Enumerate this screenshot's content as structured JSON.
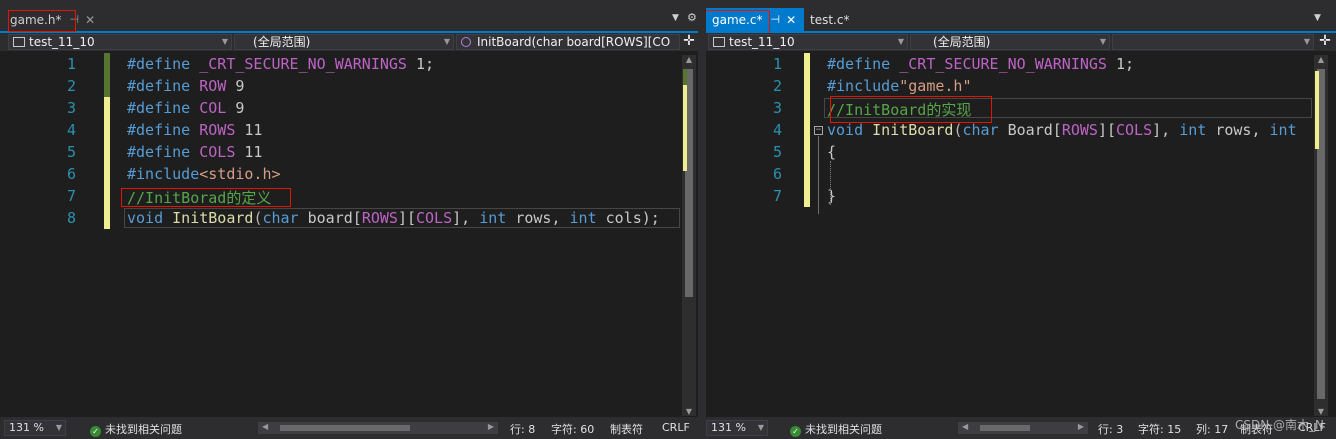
{
  "left": {
    "tabs": [
      {
        "label": "game.h*",
        "pin": "⊣",
        "close": "✕"
      }
    ],
    "nav": {
      "project": "test_11_10",
      "scope": "(全局范围)",
      "member": "InitBoard(char board[ROWS][CO"
    },
    "lines": [
      {
        "n": "1",
        "parts": [
          [
            "kw",
            "#define "
          ],
          [
            "mac",
            "_CRT_SECURE_NO_WARNINGS"
          ],
          [
            "id",
            " 1;"
          ]
        ]
      },
      {
        "n": "2",
        "parts": [
          [
            "kw",
            "#define "
          ],
          [
            "mac",
            "ROW"
          ],
          [
            "id",
            " 9"
          ]
        ]
      },
      {
        "n": "3",
        "parts": [
          [
            "kw",
            "#define "
          ],
          [
            "mac",
            "COL"
          ],
          [
            "id",
            " 9"
          ]
        ]
      },
      {
        "n": "4",
        "parts": [
          [
            "kw",
            "#define "
          ],
          [
            "mac",
            "ROWS"
          ],
          [
            "id",
            " 11"
          ]
        ]
      },
      {
        "n": "5",
        "parts": [
          [
            "kw",
            "#define "
          ],
          [
            "mac",
            "COLS"
          ],
          [
            "id",
            " 11"
          ]
        ]
      },
      {
        "n": "6",
        "parts": [
          [
            "kw",
            "#include"
          ],
          [
            "str",
            "<stdio.h>"
          ]
        ]
      },
      {
        "n": "7",
        "parts": [
          [
            "cmt",
            "//InitBorad的定义"
          ]
        ]
      },
      {
        "n": "8",
        "parts": [
          [
            "kw",
            "void "
          ],
          [
            "fn",
            "InitBoard"
          ],
          [
            "pun",
            "("
          ],
          [
            "kw",
            "char "
          ],
          [
            "id",
            "board["
          ],
          [
            "mac",
            "ROWS"
          ],
          [
            "id",
            "]["
          ],
          [
            "mac",
            "COLS"
          ],
          [
            "id",
            "], "
          ],
          [
            "kw",
            "int "
          ],
          [
            "id",
            "rows, "
          ],
          [
            "kw",
            "int "
          ],
          [
            "id",
            "cols);"
          ]
        ]
      }
    ],
    "status": {
      "zoom": "131 %",
      "issues": "未找到相关问题",
      "line": "行: 8",
      "char": "字符: 60",
      "tabs": "制表符",
      "eol": "CRLF"
    }
  },
  "right": {
    "tabs": [
      {
        "label": "game.c*",
        "pin": "⊣",
        "close": "✕"
      },
      {
        "label": "test.c*"
      }
    ],
    "nav": {
      "project": "test_11_10",
      "scope": "(全局范围)",
      "member": ""
    },
    "lines": [
      {
        "n": "1",
        "parts": [
          [
            "kw",
            "#define "
          ],
          [
            "mac",
            "_CRT_SECURE_NO_WARNINGS"
          ],
          [
            "id",
            " 1;"
          ]
        ]
      },
      {
        "n": "2",
        "parts": [
          [
            "kw",
            "#include"
          ],
          [
            "str",
            "\"game.h\""
          ]
        ]
      },
      {
        "n": "3",
        "parts": [
          [
            "cmt",
            "//InitBoard的实现"
          ]
        ]
      },
      {
        "n": "4",
        "parts": [
          [
            "kw",
            "void "
          ],
          [
            "fn",
            "InitBoard"
          ],
          [
            "pun",
            "("
          ],
          [
            "kw",
            "char "
          ],
          [
            "id",
            "Board["
          ],
          [
            "mac",
            "ROWS"
          ],
          [
            "id",
            "]["
          ],
          [
            "mac",
            "COLS"
          ],
          [
            "id",
            "], "
          ],
          [
            "kw",
            "int "
          ],
          [
            "id",
            "rows, "
          ],
          [
            "kw",
            "int"
          ]
        ]
      },
      {
        "n": "5",
        "parts": [
          [
            "id",
            "{"
          ]
        ]
      },
      {
        "n": "6",
        "parts": []
      },
      {
        "n": "7",
        "parts": [
          [
            "id",
            "}"
          ]
        ]
      }
    ],
    "status": {
      "zoom": "131 %",
      "issues": "未找到相关问题",
      "line": "行: 3",
      "char": "字符: 15",
      "col": "列: 17",
      "tabs": "制表符",
      "eol": "CRLF"
    }
  },
  "watermark": "CSDN @南木_N",
  "colors": {
    "accent": "#007acc",
    "keyword": "#569cd6",
    "macro": "#bd63c5",
    "comment": "#57a64a",
    "string": "#d69d85",
    "function": "#dcdcaa",
    "linenumber": "#2b91af",
    "highlight_box": "#e51400",
    "mod_saved": "#577430",
    "mod_unsaved": "#efef91"
  }
}
